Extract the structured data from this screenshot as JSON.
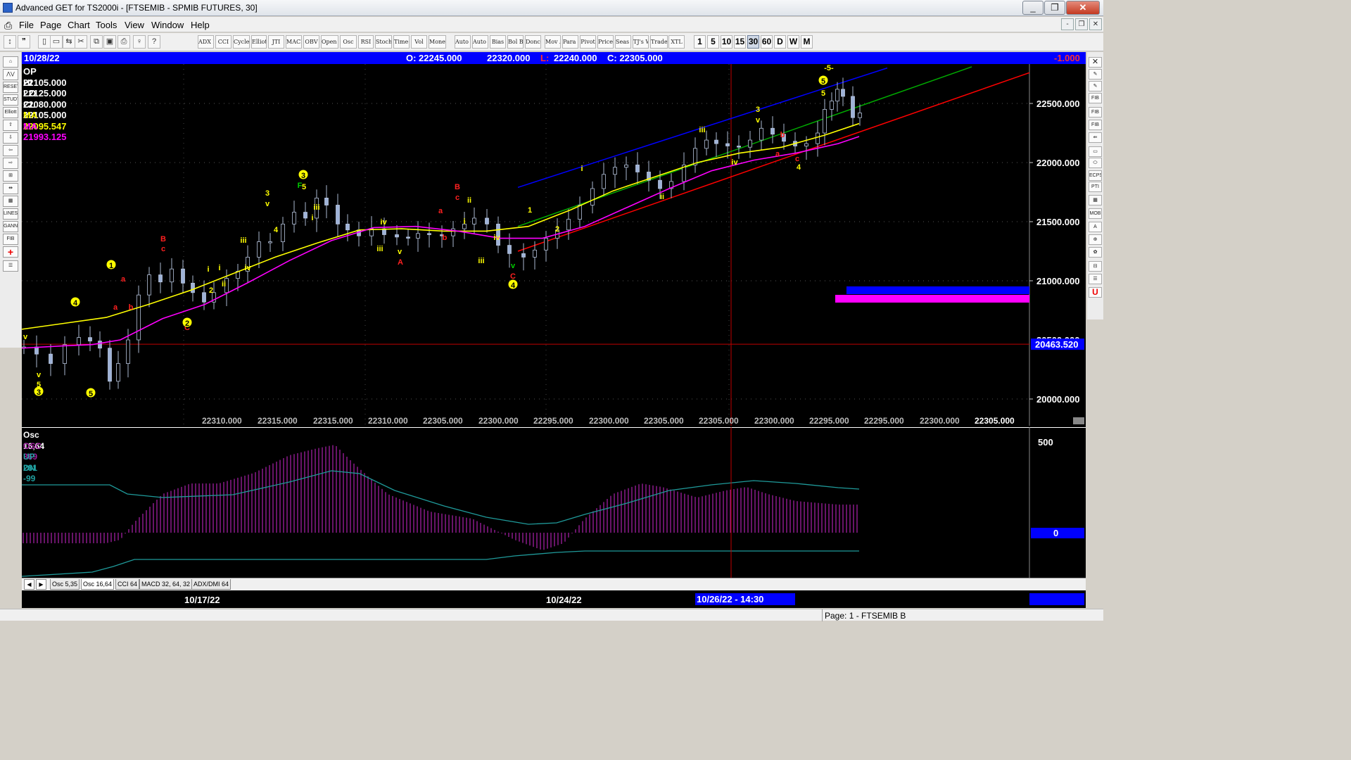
{
  "window": {
    "title": "Advanced GET for TS2000i - [FTSEMIB - SPMIB FUTURES, 30]",
    "controls": {
      "minimize": "_",
      "restore": "❐",
      "close": "✕"
    }
  },
  "menu": {
    "items": [
      "File",
      "Page",
      "Chart",
      "Tools",
      "View",
      "Window",
      "Help"
    ],
    "mdi_controls": [
      "-",
      "❐",
      "✕"
    ]
  },
  "toolbar": {
    "icon_buttons": [
      "pointer-icon",
      "quote-icon",
      "new-icon",
      "open-icon",
      "save-icon",
      "cut-icon",
      "copy-icon",
      "paste-icon",
      "print-icon",
      "info-icon",
      "help-icon"
    ],
    "study_buttons": [
      "ADX DMI",
      "CCI",
      "Cycles",
      "Elliott Trig",
      "JTI",
      "MACD",
      "OBV",
      "Open Int",
      "Osc",
      "RSI",
      "Stoch",
      "Time Clust",
      "Vol",
      "Money Flow",
      "Auto Gann",
      "Auto Trend",
      "Bias",
      "Bol Band",
      "Donch",
      "Mov Ave",
      "Para bolic",
      "Pivot",
      "Price Clust",
      "Seas onals",
      "TJ's Web",
      "Trade Profile",
      "XTL"
    ],
    "timeframes": [
      "1",
      "5",
      "10",
      "15",
      "30",
      "60",
      "D",
      "W",
      "M"
    ],
    "active_timeframe": "30"
  },
  "left_tools": [
    "open",
    "elliott-group",
    "reset",
    "study",
    "elliott",
    "up-arrow",
    "down-arrow",
    "left-arrow",
    "right-arrow",
    "fib",
    "cross",
    "grid",
    "lines",
    "gann",
    "fib2",
    "plus",
    "list"
  ],
  "right_tools": [
    "X",
    "pen",
    "pen2",
    "FIB RET",
    "FIB EXT",
    "FIB TIME",
    "arrows",
    "box",
    "ellipse",
    "ECPS",
    "PTI",
    "grid",
    "MOB",
    "A",
    "zoom",
    "paint",
    "ruler",
    "list",
    "U"
  ],
  "chart": {
    "info_bar": {
      "date": "10/28/22",
      "open": "O: 22245.000",
      "high": "22320.000",
      "low_prefix": "L:",
      "low": "22240.000",
      "close": "C: 22305.000",
      "change": "-1.000"
    },
    "ohlc_panel": [
      {
        "label": "OP",
        "value": "22105.000",
        "color": "#ffffff"
      },
      {
        "label": "HI",
        "value": "22125.000",
        "color": "#ffffff"
      },
      {
        "label": "LO",
        "value": "22080.000",
        "color": "#ffffff"
      },
      {
        "label": "CL",
        "value": "22105.000",
        "color": "#ffffff"
      },
      {
        "label": "MA",
        "value": "22095.547",
        "color": "#ffff00"
      },
      {
        "label": "MA",
        "value": "21993.125",
        "color": "#ff00ff"
      }
    ],
    "price_axis": {
      "ticks": [
        "22500.000",
        "22000.000",
        "21500.000",
        "21000.000",
        "20000.000"
      ],
      "partial_tick": "20500.000",
      "cursor_price": "20463.520"
    },
    "pivot_values": [
      "22310.000",
      "22315.000",
      "22315.000",
      "22310.000",
      "22305.000",
      "22300.000",
      "22295.000",
      "22300.000",
      "22305.000",
      "22305.000",
      "22300.000",
      "22295.000",
      "22295.000",
      "22300.000",
      "22305.000"
    ],
    "wave_labels": [
      {
        "t": "v",
        "c": "#ffff00"
      },
      {
        "t": "v",
        "c": "#ffff00"
      },
      {
        "t": "5",
        "c": "#ffff00"
      },
      {
        "t": "3",
        "c": "#ffff00",
        "circle": true
      },
      {
        "t": "5",
        "c": "#ffff00",
        "circle": true
      },
      {
        "t": "4",
        "c": "#ffff00",
        "circle": true
      },
      {
        "t": "1",
        "c": "#ffff00",
        "circle": true
      },
      {
        "t": "a",
        "c": "#ff2020"
      },
      {
        "t": "a",
        "c": "#ff2020"
      },
      {
        "t": "b",
        "c": "#ff2020"
      },
      {
        "t": "B",
        "c": "#ff2020"
      },
      {
        "t": "c",
        "c": "#ff2020"
      },
      {
        "t": "C",
        "c": "#ff2020"
      },
      {
        "t": "2",
        "c": "#ffff00",
        "circle": true
      },
      {
        "t": "i",
        "c": "#ffff00"
      },
      {
        "t": "i",
        "c": "#ffff00"
      },
      {
        "t": "2",
        "c": "#ffff00"
      },
      {
        "t": "ii",
        "c": "#ffff00"
      },
      {
        "t": "iii",
        "c": "#ffff00"
      },
      {
        "t": "iv",
        "c": "#ffff00"
      },
      {
        "t": "3",
        "c": "#ffff00"
      },
      {
        "t": "v",
        "c": "#ffff00"
      },
      {
        "t": "4",
        "c": "#ffff00"
      },
      {
        "t": "3",
        "c": "#ffff00",
        "circle": true
      },
      {
        "t": "F",
        "c": "#00cc00"
      },
      {
        "t": "5",
        "c": "#ffff00"
      },
      {
        "t": "iii",
        "c": "#ffff00"
      },
      {
        "t": "i",
        "c": "#ffff00"
      },
      {
        "t": "iv",
        "c": "#ffff00"
      },
      {
        "t": "iii",
        "c": "#ffff00"
      },
      {
        "t": "v",
        "c": "#ffff00"
      },
      {
        "t": "A",
        "c": "#ff2020"
      },
      {
        "t": "a",
        "c": "#ff2020"
      },
      {
        "t": "b",
        "c": "#ff2020"
      },
      {
        "t": "B",
        "c": "#ff2020"
      },
      {
        "t": "c",
        "c": "#ff2020"
      },
      {
        "t": "ii",
        "c": "#ffff00"
      },
      {
        "t": "i",
        "c": "#ffff00"
      },
      {
        "t": "iv",
        "c": "#ffff00"
      },
      {
        "t": "iii",
        "c": "#ffff00"
      },
      {
        "t": "v",
        "c": "#00cc00"
      },
      {
        "t": "C",
        "c": "#ff2020"
      },
      {
        "t": "4",
        "c": "#ffff00",
        "circle": true
      },
      {
        "t": "1",
        "c": "#ffff00"
      },
      {
        "t": "2",
        "c": "#ffff00"
      },
      {
        "t": "i",
        "c": "#ffff00"
      },
      {
        "t": "iii",
        "c": "#ffff00"
      },
      {
        "t": "ii",
        "c": "#ffff00"
      },
      {
        "t": "iv",
        "c": "#ffff00"
      },
      {
        "t": "3",
        "c": "#ffff00"
      },
      {
        "t": "v",
        "c": "#ffff00"
      },
      {
        "t": "b",
        "c": "#ff2020"
      },
      {
        "t": "a",
        "c": "#ff2020"
      },
      {
        "t": "c",
        "c": "#ff2020"
      },
      {
        "t": "4",
        "c": "#ffff00"
      },
      {
        "t": "-5-",
        "c": "#ffff00"
      },
      {
        "t": "5",
        "c": "#ffff00",
        "circle": true
      },
      {
        "t": "5",
        "c": "#ffff00"
      }
    ],
    "colors": {
      "background": "#000000",
      "info_bar": "#0000ff",
      "ma_fast": "#ffff00",
      "ma_slow": "#ff00ff",
      "channel_upper": "#0000ff",
      "channel_mid": "#00aa00",
      "channel_lower": "#ff0000",
      "projection_blue": "#0000ff",
      "projection_magenta": "#ff00ff"
    }
  },
  "oscillator": {
    "labels": [
      {
        "text": "Osc 16,64",
        "color": "#ffffff"
      },
      {
        "text": "OSC 369",
        "color": "#a020a0"
      },
      {
        "text": "UP  281",
        "color": "#20a0a0"
      },
      {
        "text": "DN  -99",
        "color": "#20a0a0"
      }
    ],
    "axis": {
      "top": "500",
      "zero": "0"
    },
    "tabs": [
      "Osc 5,35",
      "Osc 16,64",
      "CCI 64",
      "MACD 32, 64, 32",
      "ADX/DMI 64"
    ],
    "active_tab": "Osc 16,64"
  },
  "date_axis": {
    "labels": [
      "10/17/22",
      "10/24/22"
    ],
    "cursor": "10/26/22 - 14:30"
  },
  "status": {
    "page": "Page: 1 - FTSEMIB B"
  }
}
